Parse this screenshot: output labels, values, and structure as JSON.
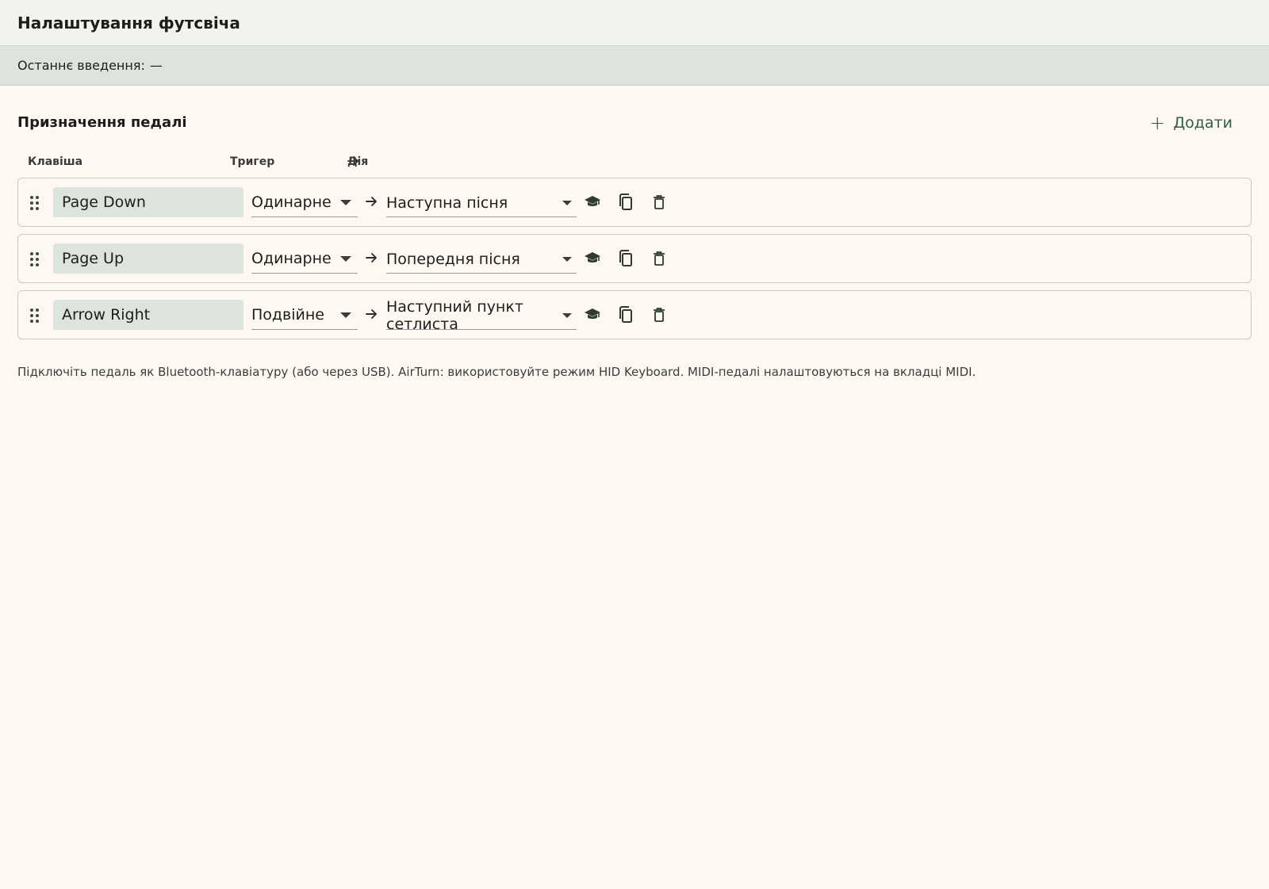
{
  "header": {
    "title": "Налаштування футсвіча"
  },
  "status": {
    "label": "Останнє введення:",
    "value": "—"
  },
  "section": {
    "title": "Призначення педалі",
    "add_label": "Додати"
  },
  "columns": {
    "key": "Клавіша",
    "trigger": "Тригер",
    "action": "Дія"
  },
  "mappings": [
    {
      "key": "Page Down",
      "trigger": "Одинарне",
      "action": "Наступна пісня"
    },
    {
      "key": "Page Up",
      "trigger": "Одинарне",
      "action": "Попередня пісня"
    },
    {
      "key": "Arrow Right",
      "trigger": "Подвійне",
      "action": "Наступний пункт сетлиста"
    }
  ],
  "help": "Підключіть педаль як Bluetooth-клавіатуру (або через USB). AirTurn: використовуйте режим HID Keyboard. MIDI-педалі налаштовуються на вкладці MIDI.",
  "icons": {
    "drag": "drag-handle-icon",
    "arrow": "arrow-right-icon",
    "learn": "school-icon",
    "copy": "copy-icon",
    "delete": "delete-icon",
    "add": "plus-icon"
  },
  "colors": {
    "accent": "#2f5d46",
    "background": "#fff8f2",
    "status_bar": "#dde4de",
    "key_field": "#dde4de"
  }
}
